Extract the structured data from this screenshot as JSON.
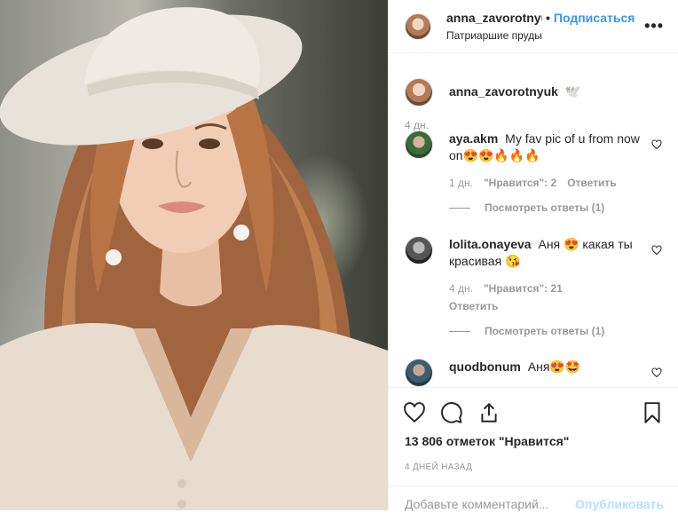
{
  "post": {
    "author": "anna_zavorotnyuk",
    "follow_label": "Подписаться",
    "separator": "•",
    "location": "Патриаршие пруды",
    "more_label": "•••"
  },
  "caption": {
    "username": "anna_zavorotnyuk",
    "text": "🕊️",
    "time": "4 дн."
  },
  "comments": [
    {
      "username": "aya.akm",
      "text": "My fav pic of u from now on😍😍🔥🔥🔥",
      "time": "1 дн.",
      "likes": "\"Нравится\": 2",
      "reply_label": "Ответить",
      "view_replies": "Посмотреть ответы (1)"
    },
    {
      "username": "lolita.onayeva",
      "text": "Аня 😍 какая ты красивая 😘",
      "time": "4 дн.",
      "likes": "\"Нравится\": 21",
      "reply_label": "Ответить",
      "view_replies": "Посмотреть ответы (1)"
    },
    {
      "username": "quodbonum",
      "text": "Аня😍🤩"
    }
  ],
  "footer": {
    "likes_text": "13 806 отметок \"Нравится\"",
    "posted": "4 ДНЕЙ НАЗАД",
    "comment_placeholder": "Добавьте комментарий...",
    "publish_label": "Опубликовать"
  },
  "icons": {
    "like": "heart-icon",
    "comment": "comment-icon",
    "share": "share-icon",
    "save": "bookmark-icon",
    "comment_like": "heart-outline-icon"
  },
  "colors": {
    "accent": "#3897f0",
    "publish_disabled": "#b2dffc",
    "muted": "#999999",
    "text": "#262626",
    "border": "#efefef"
  }
}
